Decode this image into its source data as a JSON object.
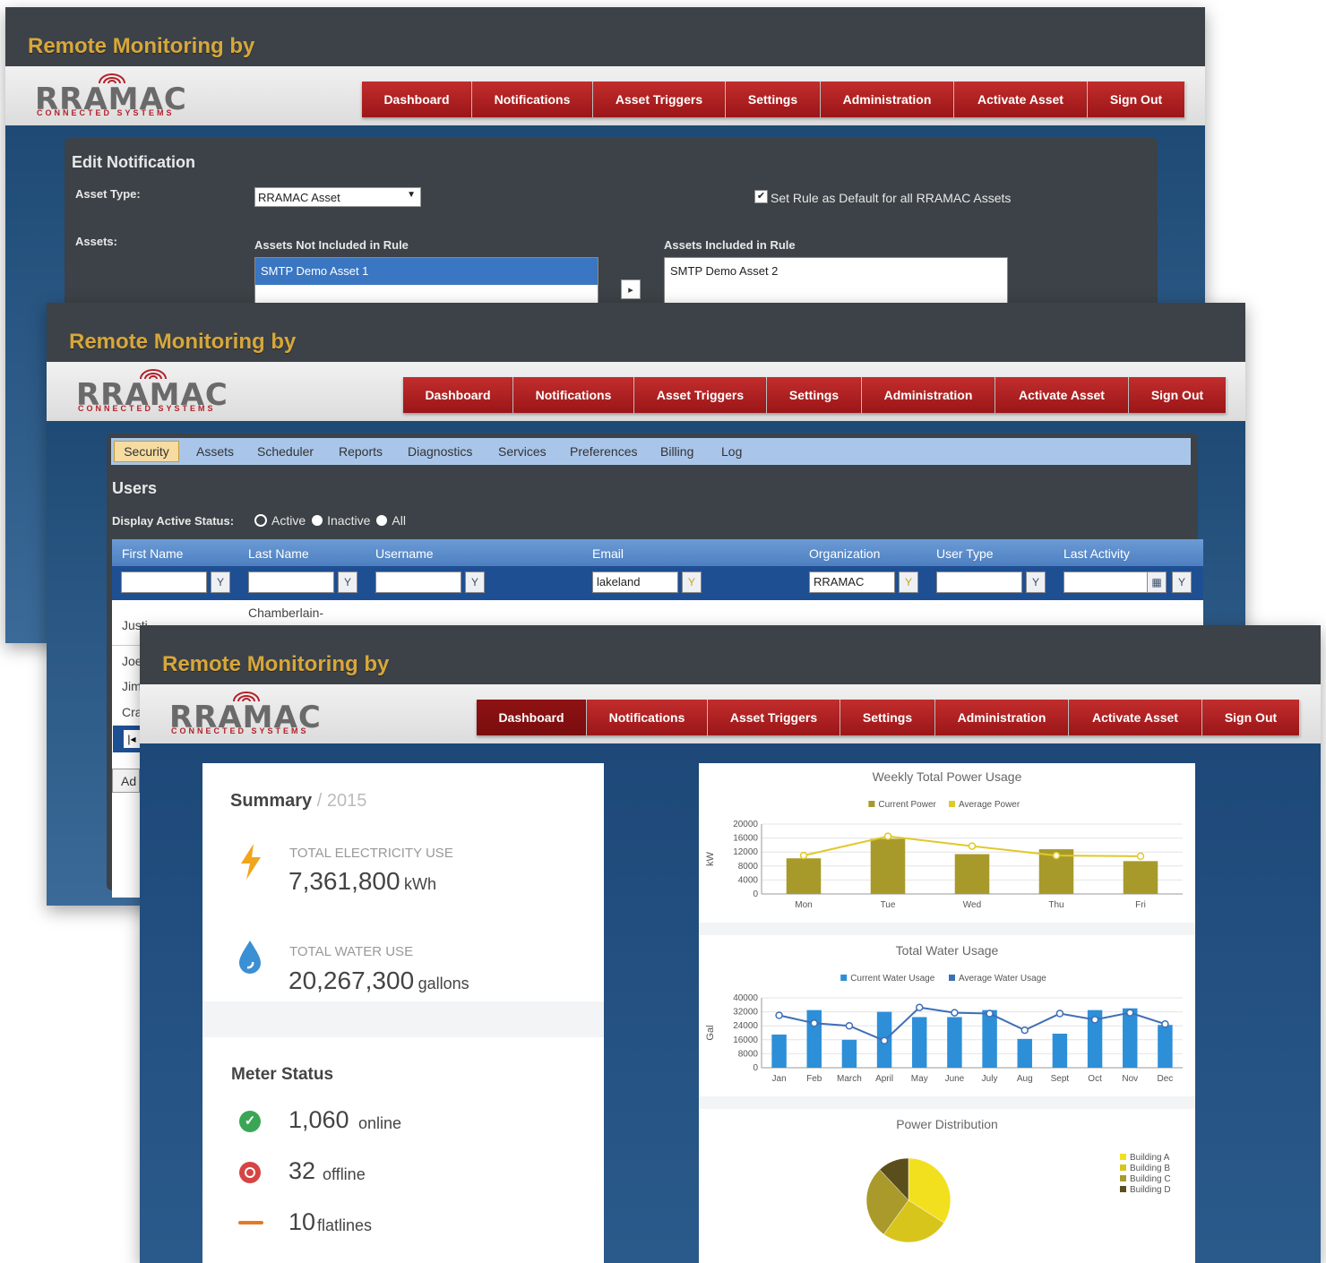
{
  "app_title": "Remote Monitoring by",
  "logo": {
    "word": "RRAMAC",
    "tagline": "CONNECTED SYSTEMS"
  },
  "nav": [
    "Dashboard",
    "Notifications",
    "Asset Triggers",
    "Settings",
    "Administration",
    "Activate Asset",
    "Sign Out"
  ],
  "colors": {
    "nav_red": "#b32224",
    "title_gold": "#d8a73a",
    "header_dark": "#3c4247",
    "chart_gold": "#a89a2a",
    "chart_blue": "#2d8fd8"
  },
  "win1": {
    "heading": "Edit Notification",
    "asset_type_label": "Asset Type:",
    "asset_type_value": "RRAMAC Asset",
    "default_rule_label": "Set Rule as Default for all RRAMAC Assets",
    "assets_label": "Assets:",
    "not_included_header": "Assets Not Included in Rule",
    "included_header": "Assets Included in Rule",
    "not_included_items": [
      "SMTP Demo Asset 1"
    ],
    "included_items": [
      "SMTP Demo Asset 2"
    ]
  },
  "win2": {
    "tabs": [
      "Security",
      "Assets",
      "Scheduler",
      "Reports",
      "Diagnostics",
      "Services",
      "Preferences",
      "Billing",
      "Log"
    ],
    "heading": "Users",
    "status_label": "Display Active Status:",
    "status_options": [
      "Active",
      "Inactive",
      "All"
    ],
    "columns": [
      "First Name",
      "Last Name",
      "Username",
      "Email",
      "Organization",
      "User Type",
      "Last Activity"
    ],
    "filters": {
      "email": "lakeland",
      "organization": "RRAMAC"
    },
    "rows": [
      {
        "first": "Justi",
        "last": "Chamberlain-"
      },
      {
        "first": "Joe",
        "last": ""
      },
      {
        "first": "Jim",
        "last": ""
      },
      {
        "first": "Cra",
        "last": ""
      }
    ],
    "add_button": "Ad"
  },
  "win3": {
    "summary_title": "Summary",
    "summary_year": "2015",
    "electricity_label": "TOTAL ELECTRICITY USE",
    "electricity_value": "7,361,800",
    "electricity_unit": "kWh",
    "water_label": "TOTAL WATER USE",
    "water_value": "20,267,300",
    "water_unit": "gallons",
    "meter_title": "Meter Status",
    "meters": [
      {
        "count": "1,060",
        "label": "online",
        "icon": "check-circle-icon",
        "color": "#3aa655"
      },
      {
        "count": "32",
        "label": "offline",
        "icon": "no-entry-icon",
        "color": "#d64545"
      },
      {
        "count": "10",
        "label": "flatlines",
        "icon": "flatline-icon",
        "color": "#e47a24"
      }
    ]
  },
  "chart_data": [
    {
      "type": "bar",
      "title": "Weekly Total Power Usage",
      "ylabel": "kW",
      "categories": [
        "Mon",
        "Tue",
        "Wed",
        "Thu",
        "Fri"
      ],
      "ylim": [
        0,
        20000
      ],
      "yticks": [
        "0",
        "4000",
        "8000",
        "12000",
        "16000",
        "20000"
      ],
      "series": [
        {
          "name": "Current Power",
          "kind": "bar",
          "color": "#a89a2a",
          "values": [
            10200,
            15800,
            11400,
            12800,
            9400
          ]
        },
        {
          "name": "Average Power",
          "kind": "line",
          "color": "#e0c92a",
          "values": [
            11000,
            16500,
            13700,
            11000,
            10800
          ]
        }
      ]
    },
    {
      "type": "bar",
      "title": "Total Water Usage",
      "ylabel": "Gal",
      "categories": [
        "Jan",
        "Feb",
        "March",
        "April",
        "May",
        "June",
        "July",
        "Aug",
        "Sept",
        "Oct",
        "Nov",
        "Dec"
      ],
      "ylim": [
        0,
        40000
      ],
      "yticks": [
        "0",
        "8000",
        "16000",
        "24000",
        "32000",
        "40000"
      ],
      "series": [
        {
          "name": "Current Water Usage",
          "kind": "bar",
          "color": "#2d8fd8",
          "values": [
            19000,
            33000,
            16000,
            32000,
            29000,
            29000,
            33000,
            16500,
            19500,
            33000,
            34000,
            24500
          ]
        },
        {
          "name": "Average Water Usage",
          "kind": "line",
          "color": "#3f6fb5",
          "values": [
            30000,
            25500,
            24000,
            15500,
            34500,
            31500,
            31000,
            21500,
            31000,
            27500,
            31500,
            25000
          ]
        }
      ]
    },
    {
      "type": "pie",
      "title": "Power Distribution",
      "series": [
        {
          "name": "",
          "values": [
            [
              "Building A",
              34
            ],
            [
              "Building B",
              26
            ],
            [
              "Building C",
              28
            ],
            [
              "Building D",
              12
            ]
          ]
        }
      ],
      "labels": [
        "Building A",
        "Building B",
        "Building C",
        "Building D"
      ],
      "colors": [
        "#f2e01f",
        "#d8c51c",
        "#a99a2b",
        "#5a4f1c"
      ]
    }
  ]
}
